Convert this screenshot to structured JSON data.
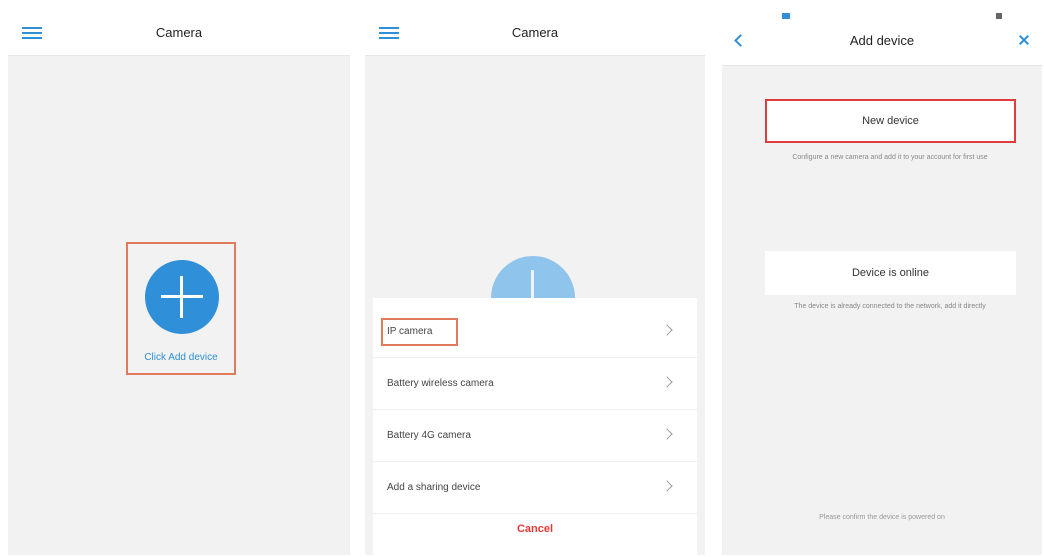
{
  "panel1": {
    "title": "Camera",
    "add_label": "Click Add device"
  },
  "panel2": {
    "title": "Camera",
    "options": [
      {
        "label": "IP camera"
      },
      {
        "label": "Battery wireless camera"
      },
      {
        "label": "Battery 4G camera"
      },
      {
        "label": "Add a sharing device"
      }
    ],
    "cancel_label": "Cancel"
  },
  "panel3": {
    "title": "Add device",
    "new_device_label": "New device",
    "new_device_desc": "Configure a new camera and add it to your account for first use",
    "device_online_label": "Device is online",
    "device_online_desc": "The device is already connected to the network, add it directly",
    "footer_note": "Please confirm the device is powered on"
  },
  "colors": {
    "accent": "#2f8fd8",
    "highlight_border": "#e03c3c",
    "cancel": "#e53935"
  },
  "icons": [
    "menu-icon",
    "plus-icon",
    "chevron-right-icon",
    "back-icon",
    "close-icon"
  ]
}
